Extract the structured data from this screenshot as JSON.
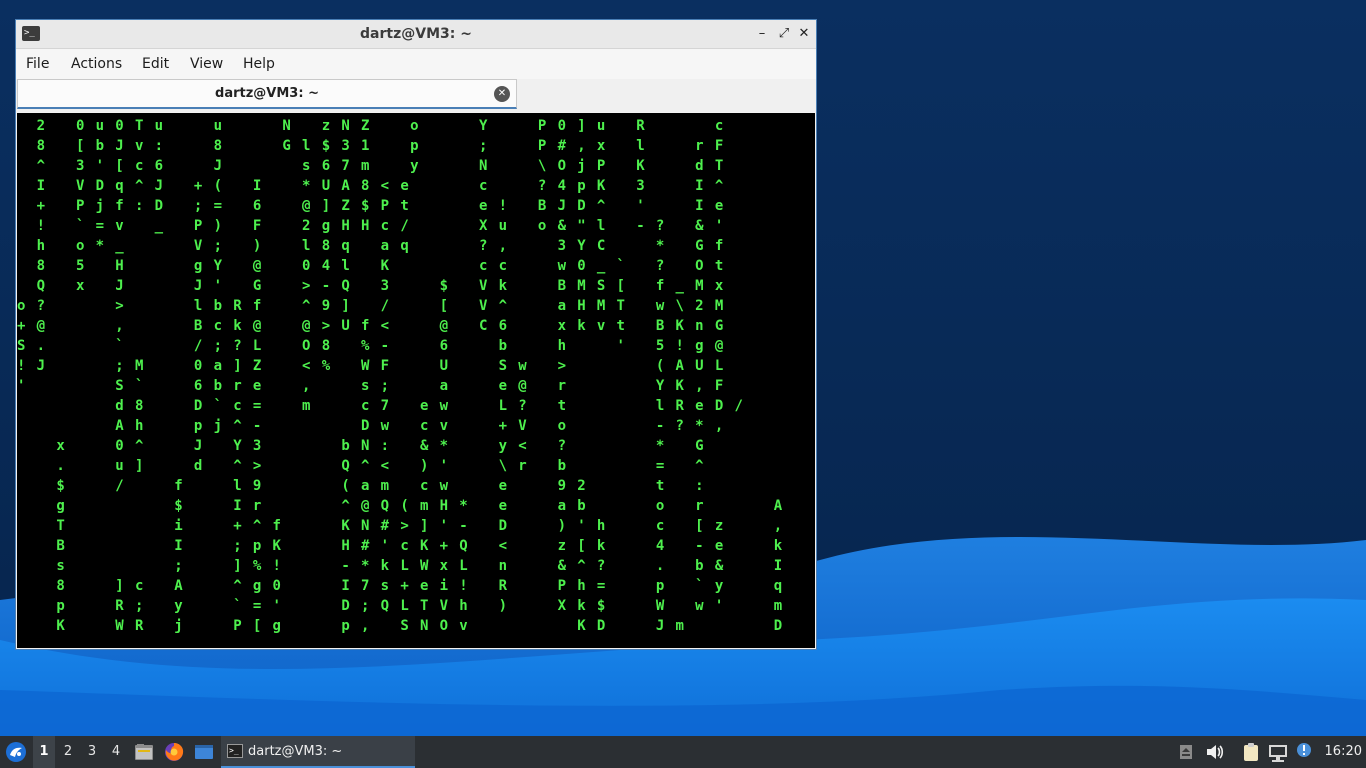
{
  "window": {
    "title": "dartz@VM3: ~",
    "minimize_glyph": "–",
    "maximize_glyph": "⤢",
    "close_glyph": "✕",
    "app_icon_glyph": ">_",
    "accent_color": "#4a7fb6"
  },
  "menubar": {
    "items": [
      "File",
      "Actions",
      "Edit",
      "View",
      "Help"
    ]
  },
  "tab": {
    "label": "dartz@VM3: ~",
    "close_glyph": "✕"
  },
  "terminal": {
    "text_color": "#4ef04e",
    "background": "#000000",
    "lines": [
      "  2   0 u 0 T u     u      N   z N Z    o      Y     P 0 ] u   R       c",
      "  8   [ b J v :     8      G l $ 3 1    p      ;     P # , x   l     r F",
      "  ^   3 ' [ c 6     J        s 6 7 m    y      N     \\ O j P   K     d T",
      "  I   V D q ^ J   + (   I    * U A 8 < e       c     ? 4 p K   3     I ^",
      "  +   P j f : D   ; =   6    @ ] Z $ P t       e !   B J D ^   '     I e",
      "  !   ` = v   _   P )   F    2 g H H c /       X u   o & \" l   - ?   & '",
      "  h   o * _       V ;   )    l 8 q   a q       ? ,     3 Y C     *   G f",
      "  8   5   H       g Y   @    0 4 l   K         c c     w 0 _ `   ?   O t",
      "  Q   x   J       J '   G    > - Q   3     $   V k     B M S [   f _ M x",
      "o ?       >       l b R f    ^ 9 ]   /     [   V ^     a H M T   w \\ 2 M",
      "+ @       ,       B c k @    @ > U f <     @   C 6     x k v t   B K n G",
      "S .       `       / ; ? L    O 8   % -     6     b     h     '   5 ! g @",
      "! J       ; M     0 a ] Z    < %   W F     U     S w   >         ( A U L",
      "'         S `     6 b r e    ,     s ;     a     e @   r         Y K , F",
      "          d 8     D ` c =    m     c 7   e w     L ?   t         l R e D /",
      "          A h     p j ^ -          D w   c v     + V   o         - ? * ,",
      "    x     0 ^     J   Y 3        b N :   & *     y <   ?         *   G",
      "    .     u ]     d   ^ >        Q ^ <   ) '     \\ r   b         =   ^",
      "    $     /     f     l 9        ( a m   c w     e     9 2       t   :",
      "    g           $     I r        ^ @ Q ( m H *   e     a b       o   r       A",
      "    T           i     + ^ f      K N # > ] ' -   D     ) ' h     c   [ z     ,",
      "    B           I     ; p K      H # ' c K + Q   <     z [ k     4   - e     k",
      "    s           ;     ] % !      - * k L W x L   n     & ^ ?     .   b &     I",
      "    8     ] c   A     ^ g 0      I 7 s + e i !   R     P h =     p   ` y     q",
      "    p     R ;   y     ` = '      D ; Q L T V h   )     X k $     W   w '     m",
      "    K     W R   j     P [ g      p ,   S N O v           K D     J m         D"
    ]
  },
  "taskbar": {
    "workspaces": [
      "1",
      "2",
      "3",
      "4"
    ],
    "active_workspace": "1",
    "launchers": [
      "file-manager-icon",
      "firefox-icon",
      "show-desktop-icon"
    ],
    "task_label": "dartz@VM3: ~",
    "clock": "16:20",
    "tray_icons": [
      "removable-drive-icon",
      "volume-icon",
      "clipboard-icon",
      "network-icon",
      "notification-icon"
    ]
  }
}
